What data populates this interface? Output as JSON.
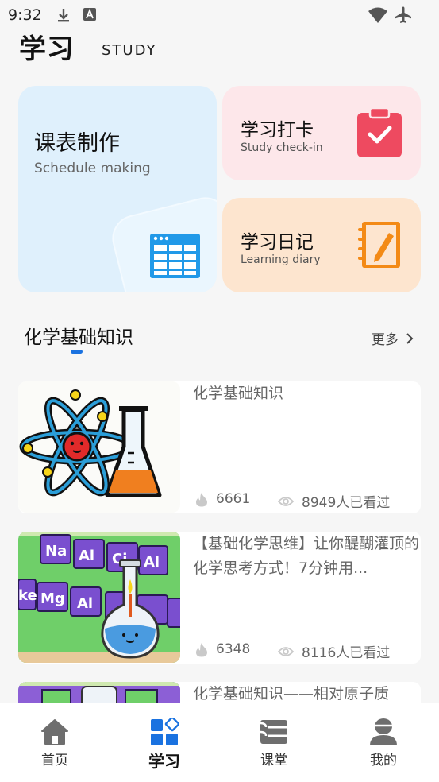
{
  "status_bar": {
    "time": "9:32",
    "left_icons": [
      "download-icon",
      "font-icon"
    ],
    "right_icons": [
      "wifi-icon",
      "airplane-mode-icon"
    ]
  },
  "header": {
    "title": "学习",
    "subtitle": "STUDY"
  },
  "features": {
    "schedule": {
      "title": "课表制作",
      "subtitle": "Schedule making",
      "icon": "table-icon",
      "color": "#2199e8"
    },
    "checkin": {
      "title": "学习打卡",
      "subtitle": "Study check-in",
      "icon": "clipboard-check-icon",
      "color": "#ee4a60"
    },
    "diary": {
      "title": "学习日记",
      "subtitle": "Learning diary",
      "icon": "notebook-pen-icon",
      "color": "#f38a16"
    }
  },
  "section": {
    "title": "化学基础知识",
    "more_label": "更多"
  },
  "articles": [
    {
      "title": "化学基础知识",
      "likes": "6661",
      "views": "8949人已看过",
      "thumb": "atom-flask-illustration"
    },
    {
      "title": "【基础化学思维】让你醍醐灌顶的化学思考方式！7分钟用...",
      "likes": "6348",
      "views": "8116人已看过",
      "thumb": "periodic-table-flask-illustration"
    },
    {
      "title": "化学基础知识——相对原子质",
      "likes": "",
      "views": "",
      "thumb": "periodic-table-flask-illustration"
    }
  ],
  "bottom_nav": [
    {
      "label": "首页",
      "icon": "home-icon",
      "active": false
    },
    {
      "label": "学习",
      "icon": "study-grid-icon",
      "active": true
    },
    {
      "label": "课堂",
      "icon": "classroom-icon",
      "active": false
    },
    {
      "label": "我的",
      "icon": "profile-icon",
      "active": false
    }
  ],
  "colors": {
    "accent": "#1a72e0",
    "background": "#f6f6f6"
  }
}
